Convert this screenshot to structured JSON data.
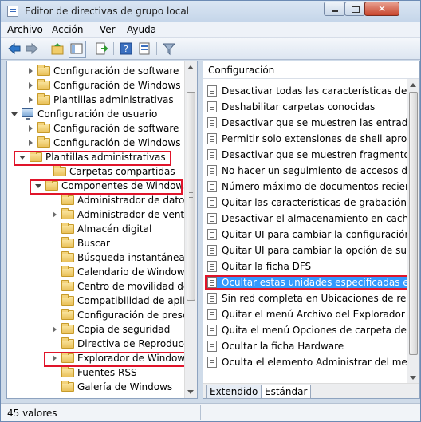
{
  "window": {
    "title": "Editor de directivas de grupo local"
  },
  "menu": [
    "Archivo",
    "Acción",
    "Ver",
    "Ayuda"
  ],
  "toolbar": {
    "icons": [
      "back-arrow-icon",
      "forward-arrow-icon",
      "up-folder-icon",
      "show-hide-tree-icon",
      "export-list-icon",
      "help-icon",
      "properties-icon",
      "filter-icon"
    ]
  },
  "tree": [
    {
      "label": "Configuración de software",
      "icon": "folder",
      "expander": "closed"
    },
    {
      "label": "Configuración de Windows",
      "icon": "folder",
      "expander": "closed"
    },
    {
      "label": "Plantillas administrativas",
      "icon": "folder",
      "expander": "closed"
    },
    {
      "label": "Configuración de usuario",
      "icon": "computer",
      "expander": "open"
    },
    {
      "label": "Configuración de software",
      "icon": "folder",
      "expander": "closed"
    },
    {
      "label": "Configuración de Windows",
      "icon": "folder",
      "expander": "closed"
    },
    {
      "label": "Plantillas administrativas",
      "icon": "folder",
      "expander": "open",
      "highlight": true
    },
    {
      "label": "Carpetas compartidas",
      "icon": "folder",
      "expander": "none"
    },
    {
      "label": "Componentes de Windows",
      "icon": "folder",
      "expander": "open",
      "highlight": true
    },
    {
      "label": "Administrador de datos ac",
      "icon": "folder",
      "expander": "none"
    },
    {
      "label": "Administrador de ventana",
      "icon": "folder",
      "expander": "closed"
    },
    {
      "label": "Almacén digital",
      "icon": "folder",
      "expander": "none"
    },
    {
      "label": "Buscar",
      "icon": "folder",
      "expander": "none"
    },
    {
      "label": "Búsqueda instantánea",
      "icon": "folder",
      "expander": "none"
    },
    {
      "label": "Calendario de Windows",
      "icon": "folder",
      "expander": "none"
    },
    {
      "label": "Centro de movilidad de W",
      "icon": "folder",
      "expander": "none"
    },
    {
      "label": "Compatibilidad de aplicac",
      "icon": "folder",
      "expander": "none"
    },
    {
      "label": "Configuración de presenta",
      "icon": "folder",
      "expander": "none"
    },
    {
      "label": "Copia de seguridad",
      "icon": "folder",
      "expander": "closed"
    },
    {
      "label": "Directiva de Reproducció",
      "icon": "folder",
      "expander": "none"
    },
    {
      "label": "Explorador de Windows",
      "icon": "folder",
      "expander": "closed",
      "highlight": true
    },
    {
      "label": "Fuentes RSS",
      "icon": "folder",
      "expander": "none"
    },
    {
      "label": "Galería de Windows",
      "icon": "folder",
      "expander": "none"
    }
  ],
  "right_pane": {
    "header": "Configuración",
    "policies": [
      "Desactivar todas las características de bibliotec",
      "Deshabilitar carpetas conocidas",
      "Desactivar que se muestren las entradas de bús",
      "Permitir solo extensiones de shell aprobadas o",
      "Desactivar que se muestren fragmentos en el m",
      "No hacer un seguimiento de accesos directos a",
      "Número máximo de documentos recientes",
      "Quitar las características de grabación de CD",
      "Desactivar el almacenamiento en caché de imá",
      "Quitar UI para cambiar la configuración de la a",
      "Quitar UI para cambiar la opción de subrayado",
      "Quitar la ficha DFS",
      "Ocultar estas unidades especificadas en Mi PC",
      "Sin red completa en Ubicaciones de red",
      "Quitar el menú Archivo del Explorador de Windo",
      "Quita el menú Opciones de carpeta del menú H",
      "Ocultar la ficha Hardware",
      "Oculta el elemento Administrar del menú conte"
    ],
    "selected_index": 12
  },
  "tabs": [
    {
      "label": "Extendido",
      "active": false
    },
    {
      "label": "Estándar",
      "active": true
    }
  ],
  "status": {
    "text": "45 valores"
  },
  "colors": {
    "selection": "#3399ff",
    "highlight_box": "#e0142a",
    "chrome": "#cfdbe9"
  }
}
